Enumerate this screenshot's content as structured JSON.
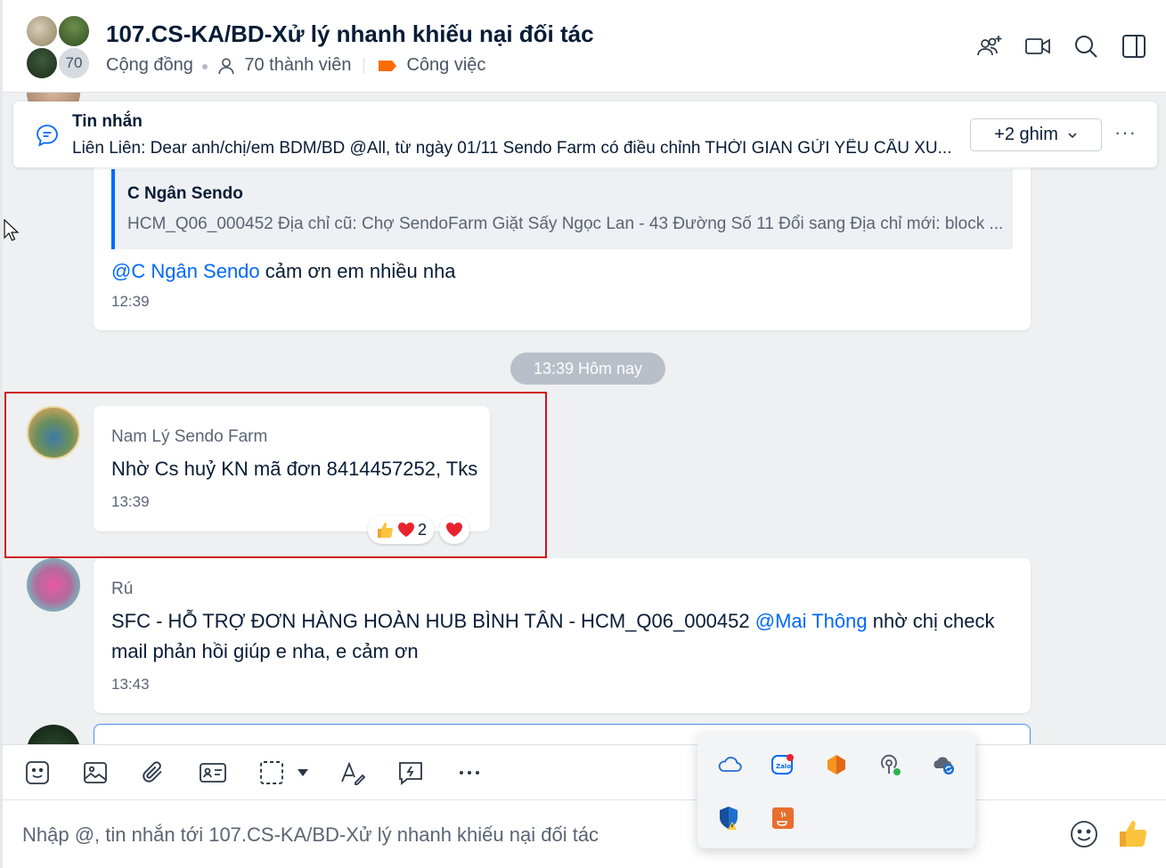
{
  "header": {
    "member_badge": "70",
    "title": "107.CS-KA/BD-Xử lý nhanh khiếu nại đối tác",
    "community_label": "Cộng đồng",
    "members_label": "70 thành viên",
    "tag_label": "Công việc",
    "tag_color": "#ff6a00"
  },
  "pinned": {
    "title": "Tin nhắn",
    "text": "Liên Liên: Dear anh/chị/em BDM/BD @All, từ ngày 01/11 Sendo Farm có điều chỉnh THỜI GIAN GỬI YÊU CẦU XU...",
    "more_label": "+2 ghim"
  },
  "messages": [
    {
      "quote_name": "C Ngân Sendo",
      "quote_text": "HCM_Q06_000452 Địa chỉ cũ: Chợ SendoFarm Giặt Sấy Ngọc Lan - 43 Đường Số 11 Đổi sang Địa chỉ mới: block ...",
      "mention": "@C Ngân Sendo",
      "text": " cảm ơn em nhiều nha",
      "time": "12:39"
    },
    {
      "sender": "Nam Lý Sendo Farm",
      "text": "Nhờ Cs huỷ KN mã đơn 8414457252, Tks",
      "time": "13:39",
      "reaction_count": "2"
    },
    {
      "sender": "Rú",
      "text_before": "SFC - HỖ TRỢ ĐƠN HÀNG HOÀN HUB BÌNH TÂN - HCM_Q06_000452 ",
      "mention": "@Mai Thông",
      "text_after": " nhờ chị check mail phản hồi giúp e nha, e cảm ơn",
      "time": "13:43"
    }
  ],
  "date_divider": "13:39 Hôm nay",
  "composer": {
    "placeholder": "Nhập @, tin nhắn tới 107.CS-KA/BD-Xử lý nhanh khiếu nại đối tác"
  },
  "colors": {
    "accent": "#0068ff",
    "highlight": "#d0121b"
  }
}
